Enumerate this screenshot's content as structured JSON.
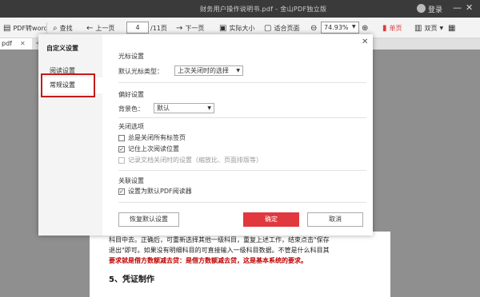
{
  "window": {
    "title": "财务用户操作说明书.pdf - 金山PDF独立版",
    "login_label": "登录",
    "minimize_glyph": "—",
    "close_glyph": "✕"
  },
  "toolbar": {
    "app_label": "PDF转word",
    "find_label": "查找",
    "prev_label": "上一页",
    "page_value": "4",
    "page_total": "/11页",
    "next_label": "下一页",
    "actual_size_label": "实际大小",
    "fit_page_label": "适合页面",
    "zoom_value": "74.93%",
    "single_label": "单页",
    "double_label": "双页"
  },
  "tabs": {
    "doc_tab_label": "pdf",
    "tab_close": "✕",
    "add_tab": "+"
  },
  "dialog": {
    "sidebar": {
      "title": "自定义设置",
      "items": [
        {
          "label": "阅读设置"
        },
        {
          "label": "常规设置"
        }
      ]
    },
    "close_glyph": "✕",
    "cursor": {
      "section_title": "光标设置",
      "default_cursor_label": "默认光标类型：",
      "default_cursor_value": "上次关闭时的选择"
    },
    "preference": {
      "section_title": "偏好设置",
      "bg_label": "背景色：",
      "bg_value": "默认"
    },
    "close_options": {
      "section_title": "关闭选项",
      "options": [
        {
          "label": "总是关闭所有标签页",
          "checked": false,
          "disabled": false
        },
        {
          "label": "记住上次阅读位置",
          "checked": true,
          "disabled": false
        },
        {
          "label": "记录文档关闭时的设置（缩放比、页面排版等）",
          "checked": false,
          "disabled": true
        }
      ]
    },
    "association": {
      "section_title": "关联设置",
      "default_reader_label": "设置为默认PDF阅读器",
      "default_reader_checked": true
    },
    "buttons": {
      "restore_label": "恢复默认设置",
      "ok_label": "确定",
      "cancel_label": "取消"
    }
  },
  "document": {
    "line1": "科目中去。正确后，可重新选择其他一级科目，重复上述工作，结束点击\"保存",
    "line2": "退出\"即可。如果没有明细科目的可直接输入一级科目数据。不管是什么科目其",
    "line3": "要求就是借方数额减去贷：是借方数额减去贷，这是基本系统的要求。",
    "heading": "5、凭证制作"
  },
  "colors": {
    "accent": "#e0383e",
    "highlight_border": "#c41a1a",
    "title_bar": "#3a3a3a"
  }
}
